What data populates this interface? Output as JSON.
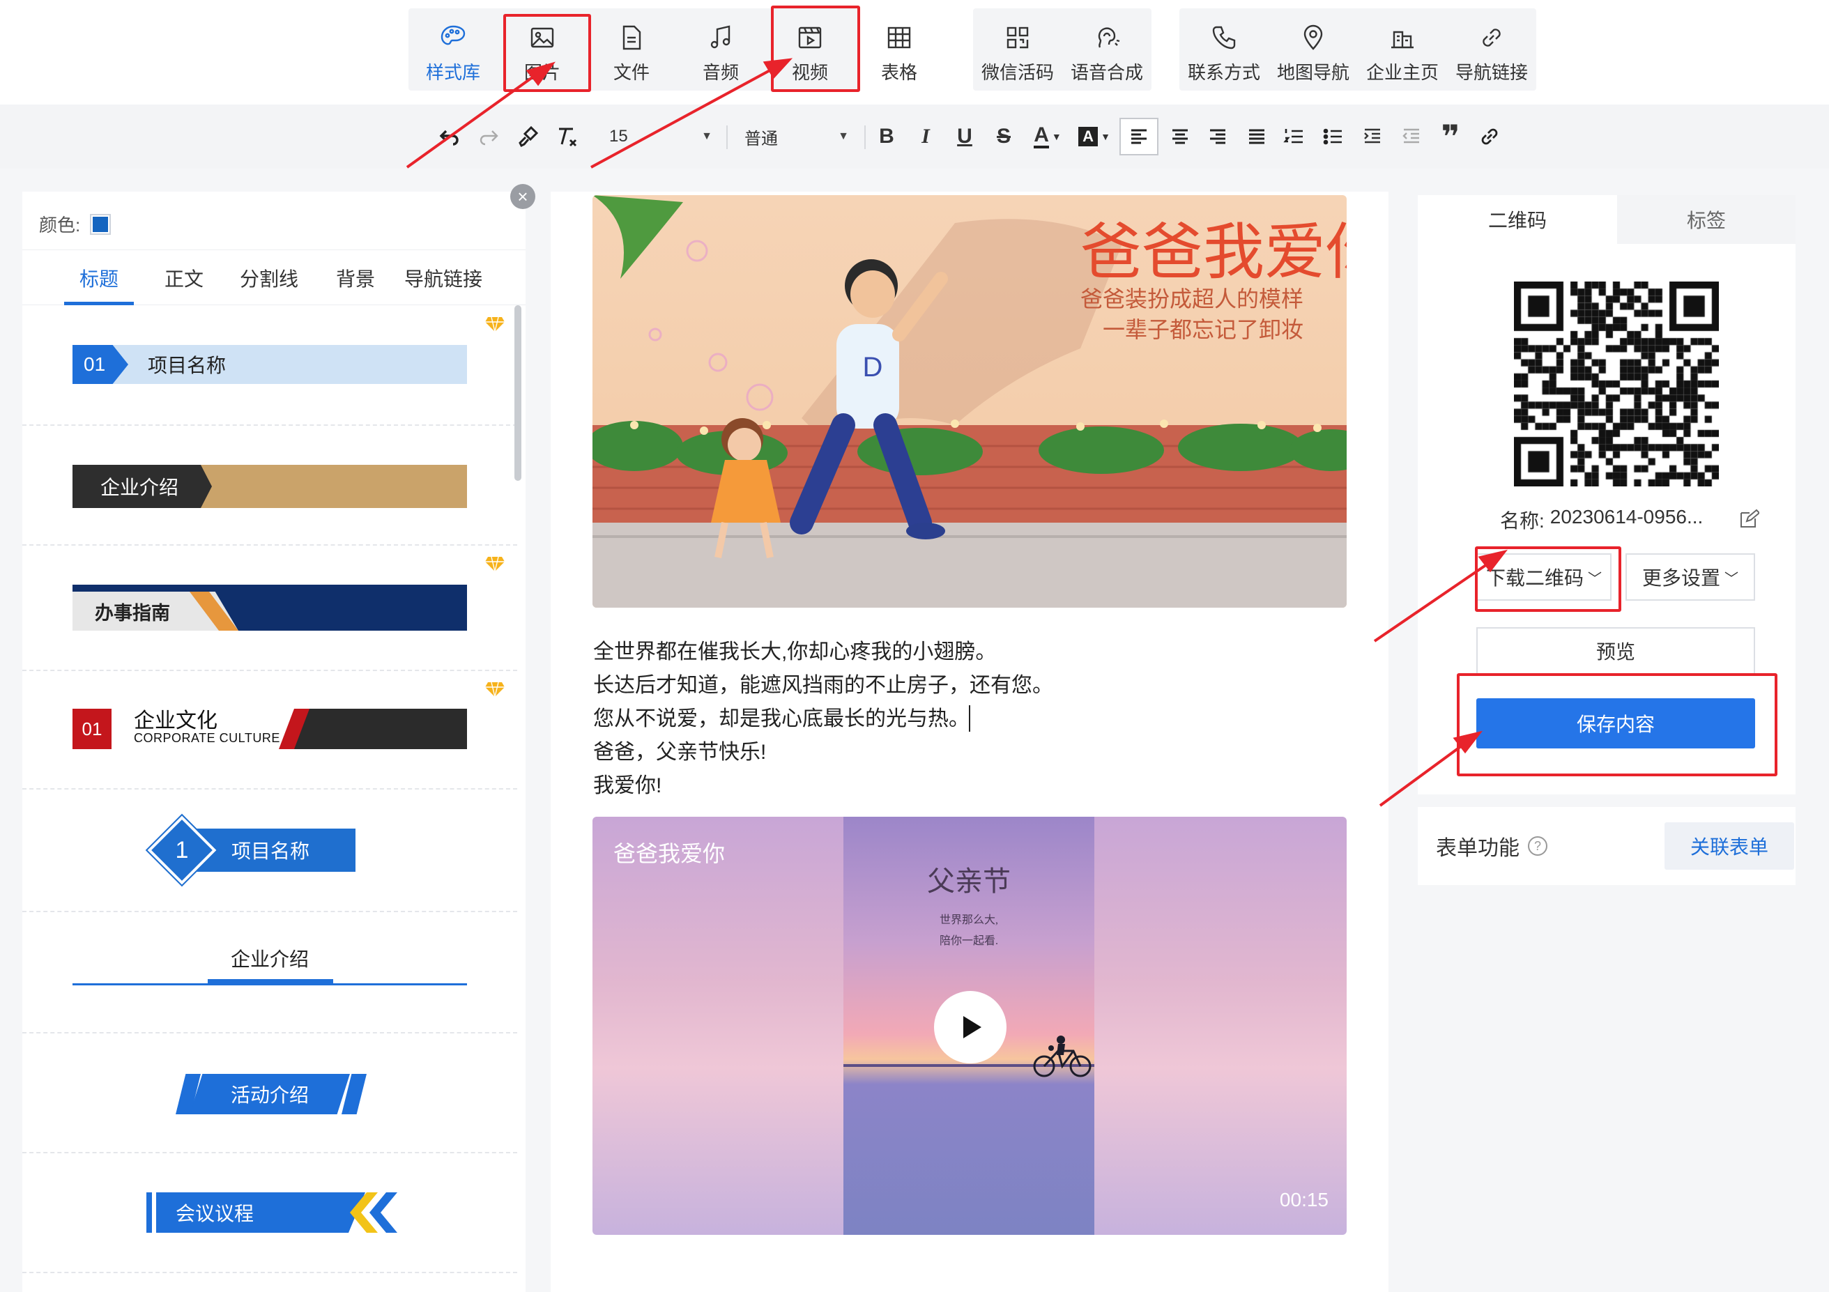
{
  "toolbar": {
    "items": [
      {
        "label": "样式库",
        "icon": "palette-icon"
      },
      {
        "label": "图片",
        "icon": "image-icon"
      },
      {
        "label": "文件",
        "icon": "file-icon"
      },
      {
        "label": "音频",
        "icon": "music-icon"
      },
      {
        "label": "视频",
        "icon": "video-icon"
      },
      {
        "label": "表格",
        "icon": "table-icon"
      },
      {
        "label": "微信活码",
        "icon": "qr-grid-icon"
      },
      {
        "label": "语音合成",
        "icon": "voice-icon"
      },
      {
        "label": "联系方式",
        "icon": "phone-icon"
      },
      {
        "label": "地图导航",
        "icon": "map-pin-icon"
      },
      {
        "label": "企业主页",
        "icon": "building-icon"
      },
      {
        "label": "导航链接",
        "icon": "link-icon"
      }
    ]
  },
  "format": {
    "font_size": "15",
    "paragraph": "普通",
    "bold": "B",
    "italic": "I",
    "underline": "U",
    "strike": "S",
    "font_color": "A",
    "bg_color": "A",
    "quote": "❞"
  },
  "left": {
    "color_label": "颜色:",
    "tabs": [
      "标题",
      "正文",
      "分割线",
      "背景",
      "导航链接"
    ],
    "styles": {
      "s1_num": "01",
      "s1_text": "项目名称",
      "s2_text": "企业介绍",
      "s3_text": "办事指南",
      "s4_num": "01",
      "s4_text": "企业文化",
      "s4_sub": "CORPORATE CULTURE",
      "s5_num": "1",
      "s5_text": "项目名称",
      "s6_text": "企业介绍",
      "s7_text": "活动介绍",
      "s8_text": "会议议程"
    }
  },
  "editor": {
    "banner_title": "爸爸我爱你",
    "banner_sub1": "爸爸装扮成超人的模样",
    "banner_sub2": "一辈子都忘记了卸妆",
    "banner_shirt": "D",
    "lines": [
      "全世界都在催我长大,你却心疼我的小翅膀。",
      "长达后才知道，能遮风挡雨的不止房子，还有您。",
      "您从不说爱，却是我心底最长的光与热。",
      "爸爸，父亲节快乐!",
      "我爱你!"
    ],
    "video_title": "爸爸我爱你",
    "poster_title": "父亲节",
    "poster_line1": "世界那么大,",
    "poster_line2": "陪你一起看.",
    "video_time": "00:15"
  },
  "right": {
    "tabs": [
      "二维码",
      "标签"
    ],
    "name_label": "名称:",
    "name_value": "20230614-0956...",
    "download_label": "下载二维码",
    "more_label": "更多设置",
    "preview_label": "预览",
    "save_label": "保存内容",
    "form_label": "表单功能",
    "link_form_label": "关联表单"
  },
  "colors": {
    "accent": "#1e6fd9",
    "annotation": "#e8232b",
    "save_button": "#2575e8"
  }
}
